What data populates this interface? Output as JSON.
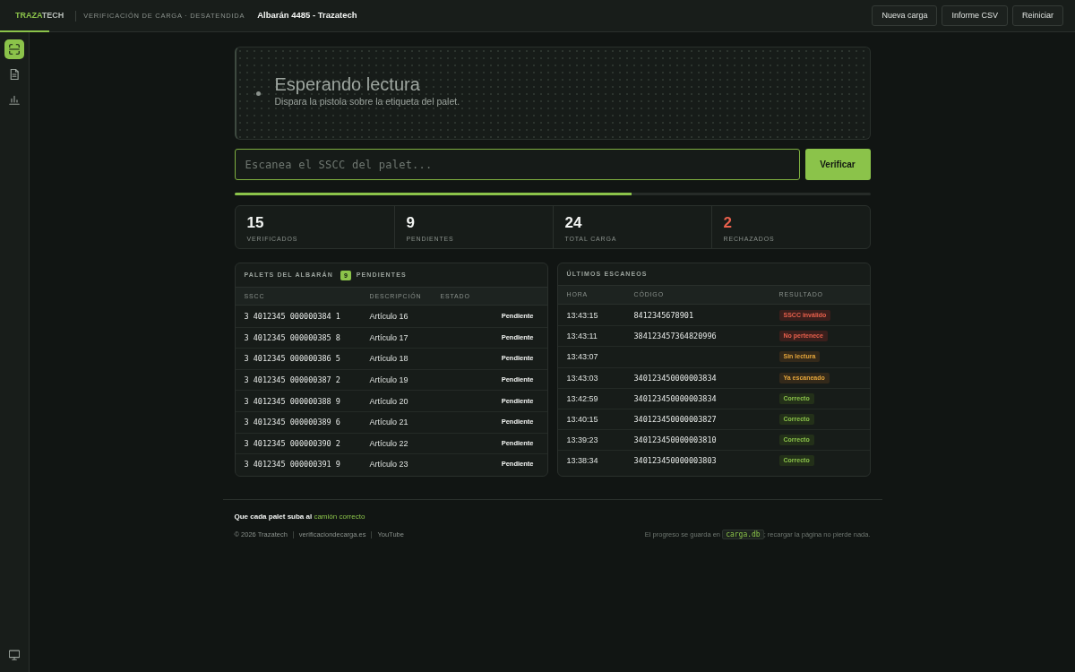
{
  "header": {
    "logo_accent": "TRAZA",
    "logo_rest": "TECH",
    "subtitle": "VERIFICACIÓN DE CARGA · DESATENDIDA",
    "title": "Albarán 4485 - Trazatech",
    "buttons": [
      "Nueva carga",
      "Informe CSV",
      "Reiniciar"
    ]
  },
  "sidebar": {
    "items": [
      {
        "selected": true
      },
      {
        "selected": false
      },
      {
        "selected": false
      }
    ],
    "bottom_items": [
      {
        "selected": false
      }
    ]
  },
  "scanner": {
    "active": false,
    "title": "Esperando lectura",
    "message": "Dispara la pistola sobre la etiqueta del palet."
  },
  "scan_input": {
    "placeholder": "Escanea el SSCC del palet...",
    "button": "Verificar"
  },
  "progress": {
    "level": 0.625
  },
  "stats": [
    {
      "value": "15",
      "label": "VERIFICADOS",
      "kind": "normal"
    },
    {
      "value": "9",
      "label": "PENDIENTES",
      "kind": "normal"
    },
    {
      "value": "24",
      "label": "TOTAL CARGA",
      "kind": "normal"
    },
    {
      "value": "2",
      "label": "RECHAZADOS",
      "kind": "alert"
    }
  ],
  "pallets": {
    "title": "PALETS DEL ALBARÁN",
    "count": "9",
    "count_label": "PENDIENTES",
    "columns": [
      "SSCC",
      "DESCRIPCIÓN",
      "ESTADO"
    ],
    "rows": [
      {
        "sscc": "3 4012345 000000384 1",
        "description": "Artículo 16",
        "status": "Pendiente"
      },
      {
        "sscc": "3 4012345 000000385 8",
        "description": "Artículo 17",
        "status": "Pendiente"
      },
      {
        "sscc": "3 4012345 000000386 5",
        "description": "Artículo 18",
        "status": "Pendiente"
      },
      {
        "sscc": "3 4012345 000000387 2",
        "description": "Artículo 19",
        "status": "Pendiente"
      },
      {
        "sscc": "3 4012345 000000388 9",
        "description": "Artículo 20",
        "status": "Pendiente"
      },
      {
        "sscc": "3 4012345 000000389 6",
        "description": "Artículo 21",
        "status": "Pendiente"
      },
      {
        "sscc": "3 4012345 000000390 2",
        "description": "Artículo 22",
        "status": "Pendiente"
      },
      {
        "sscc": "3 4012345 000000391 9",
        "description": "Artículo 23",
        "status": "Pendiente"
      }
    ]
  },
  "scans": {
    "title": "ÚLTIMOS ESCANEOS",
    "columns": [
      "HORA",
      "CÓDIGO",
      "RESULTADO"
    ],
    "rows": [
      {
        "time": "13:43:15",
        "code": "8412345678901",
        "result": "SSCC inválido",
        "kind": "error"
      },
      {
        "time": "13:43:11",
        "code": "384123457364820996",
        "result": "No pertenece",
        "kind": "error"
      },
      {
        "time": "13:43:07",
        "result": "Sin lectura",
        "kind": "warning"
      },
      {
        "time": "13:43:03",
        "code": "340123450000003834",
        "result": "Ya escaneado",
        "kind": "warning"
      },
      {
        "time": "13:42:59",
        "code": "340123450000003834",
        "result": "Correcto",
        "kind": "ok"
      },
      {
        "time": "13:40:15",
        "code": "340123450000003827",
        "result": "Correcto",
        "kind": "ok"
      },
      {
        "time": "13:39:23",
        "code": "340123450000003810",
        "result": "Correcto",
        "kind": "ok"
      },
      {
        "time": "13:38:34",
        "code": "340123450000003803",
        "result": "Correcto",
        "kind": "ok"
      }
    ]
  },
  "footer": {
    "tagline": "Que cada palet suba al",
    "tagline_link": "camión correcto",
    "copyright": "© 2026 Trazatech",
    "links": [
      "verificaciondecarga.es",
      "YouTube"
    ],
    "note_before": "El progreso se guarda en",
    "note_code": "carga.db",
    "note_after": "; recargar la página no pierde nada."
  }
}
